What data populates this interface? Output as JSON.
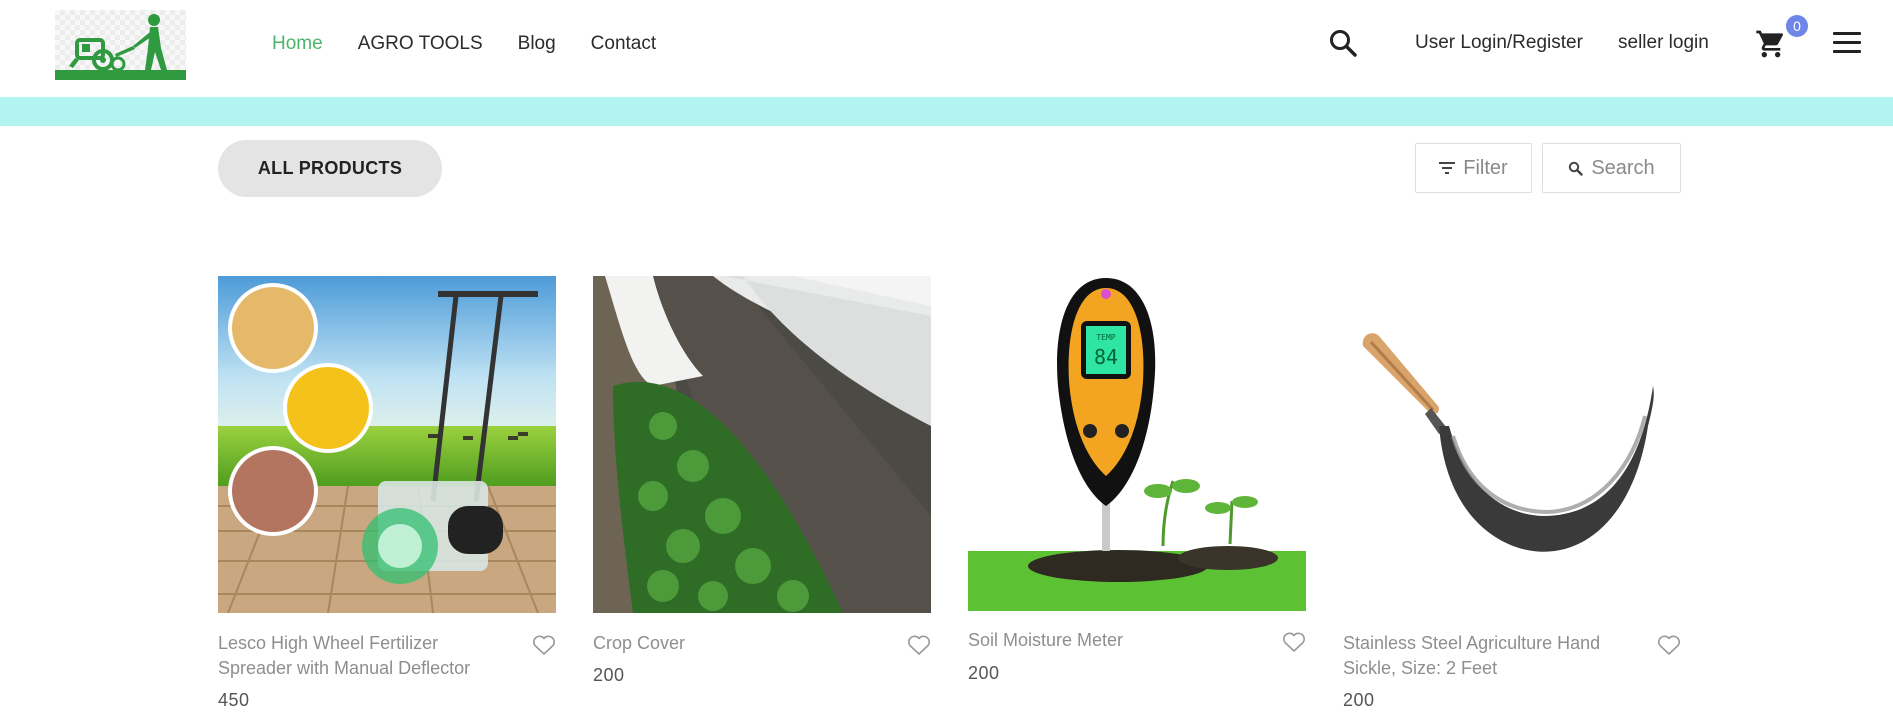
{
  "nav": {
    "items": [
      {
        "label": "Home",
        "active": true
      },
      {
        "label": "AGRO TOOLS",
        "active": false
      },
      {
        "label": "Blog",
        "active": false
      },
      {
        "label": "Contact",
        "active": false
      }
    ]
  },
  "header": {
    "user_login_label": "User Login/Register",
    "seller_login_label": "seller login",
    "cart_count": "0",
    "icons": [
      "search-icon",
      "cart-icon",
      "menu-icon",
      "logo-farmer-tiller"
    ]
  },
  "toolbar": {
    "all_products_label": "ALL PRODUCTS",
    "filter_label": "Filter",
    "search_label": "Search"
  },
  "products": [
    {
      "name": "Lesco High Wheel Fertilizer Spreader with Manual Deflector",
      "price": "450"
    },
    {
      "name": "Crop Cover",
      "price": "200"
    },
    {
      "name": "Soil Moisture Meter",
      "price": "200"
    },
    {
      "name": "Stainless Steel Agriculture Hand Sickle, Size: 2 Feet",
      "price": "200"
    }
  ],
  "images": {
    "meter_display_label": "TEMP",
    "meter_display_value": "84"
  },
  "colors": {
    "accent_green": "#4cb36a",
    "teal_band": "#b2f4ef",
    "badge": "#6f86e8",
    "meter_yellow": "#f3a521"
  }
}
